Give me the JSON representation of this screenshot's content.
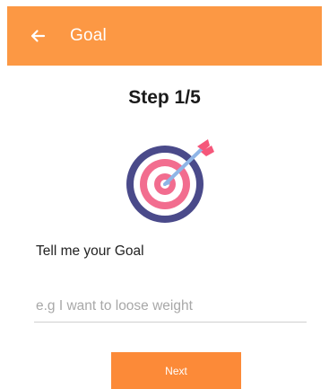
{
  "colors": {
    "accent": "#fc9844",
    "button": "#fc8a38",
    "target_ring_dark": "#4a4a8a",
    "target_ring_pink": "#f26d8f",
    "arrow": "#8fb5e6",
    "arrow_fletching": "#f5577a"
  },
  "app_bar": {
    "back_icon": "arrow-left-icon",
    "title": "Goal"
  },
  "step": {
    "title": "Step 1/5"
  },
  "illustration": {
    "icon": "target-with-arrow-icon"
  },
  "form": {
    "label": "Tell me your Goal",
    "input_value": "",
    "input_placeholder": "e.g I want to loose weight"
  },
  "actions": {
    "next_label": "Next"
  }
}
